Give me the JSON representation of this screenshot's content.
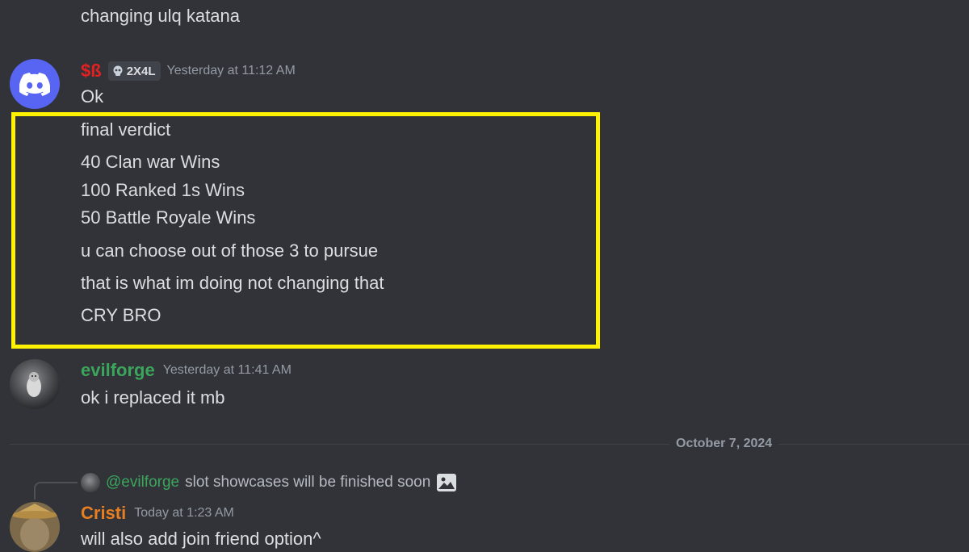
{
  "previous_message": {
    "text": "changing ulq katana"
  },
  "message1": {
    "username": "$ß",
    "username_color": "#e32121",
    "tag": "2X4L",
    "timestamp": "Yesterday at 11:12 AM",
    "lines": [
      "Ok",
      "final verdict",
      "40 Clan war Wins",
      "100 Ranked 1s Wins",
      "50 Battle Royale Wins",
      "u can choose out of those 3 to pursue",
      "that is what im doing not changing that",
      "CRY BRO"
    ],
    "avatar_icon": "discord-logo-icon"
  },
  "highlight_color": "#fff200",
  "message2": {
    "username": "evilforge",
    "username_color": "#3ba55c",
    "timestamp": "Yesterday at 11:41 AM",
    "text": "ok i replaced it mb"
  },
  "date_divider": {
    "label": "October 7, 2024"
  },
  "message3": {
    "reply": {
      "mention": "@evilforge",
      "text": "slot showcases will be finished soon",
      "attachment_icon": "image-icon"
    },
    "username": "Cristi",
    "username_color": "#e67e22",
    "timestamp": "Today at 1:23 AM",
    "text": "will also add join friend option^"
  }
}
